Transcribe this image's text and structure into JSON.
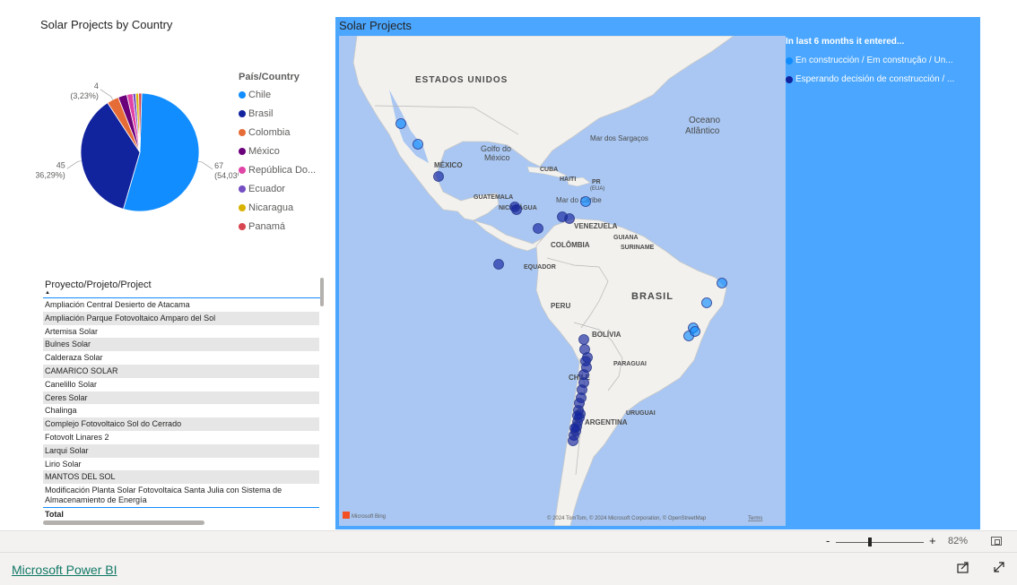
{
  "pie_visual": {
    "title": "Solar Projects by Country",
    "legend_title": "País/Country"
  },
  "chart_data": {
    "type": "pie",
    "title": "Solar Projects by Country",
    "legend_title": "País/Country",
    "legend_position": "right",
    "slices": [
      {
        "name": "Chile",
        "value": 67,
        "label": "67",
        "pct": "(54,03%)",
        "color": "#118dff"
      },
      {
        "name": "Brasil",
        "value": 45,
        "label": "45",
        "pct": "(36,29%)",
        "color": "#12239e"
      },
      {
        "name": "Colombia",
        "value": 4,
        "label": "4",
        "pct": "(3,23%)",
        "color": "#e66c37"
      },
      {
        "name": "México",
        "value": 3,
        "label": "",
        "pct": "",
        "color": "#6b007b"
      },
      {
        "name": "República Do...",
        "value": 2,
        "label": "",
        "pct": "",
        "color": "#e044a7"
      },
      {
        "name": "Ecuador",
        "value": 1,
        "label": "",
        "pct": "",
        "color": "#744ec2"
      },
      {
        "name": "Nicaragua",
        "value": 1,
        "label": "",
        "pct": "",
        "color": "#d9b300"
      },
      {
        "name": "Panamá",
        "value": 1,
        "label": "",
        "pct": "",
        "color": "#d64550"
      }
    ]
  },
  "table": {
    "header": "Proyecto/Projeto/Project",
    "rows": [
      "Ampliación Central Desierto de Atacama",
      "Ampliación Parque Fotovoltaico Amparo del Sol",
      "Artemisa Solar",
      "Bulnes Solar",
      "Calderaza Solar",
      "CAMARICO SOLAR",
      "Canelillo Solar",
      "Ceres Solar",
      "Chalinga",
      "Complejo Fotovoltaico Sol do Cerrado",
      "Fotovolt Linares 2",
      "Larqui Solar",
      "Lirio Solar",
      "MANTOS DEL SOL",
      "Modificación Planta Solar Fotovoltaica Santa Julia con Sistema de Almacenamiento de Energía"
    ],
    "total_label": "Total"
  },
  "map": {
    "title": "Solar Projects",
    "legend_title": "In last 6 months it entered...",
    "legend_items": [
      {
        "label": "En construcción / Em construção / Un...",
        "color": "#118dff"
      },
      {
        "label": "Esperando decisión de construcción / ...",
        "color": "#12239e"
      }
    ],
    "labels": {
      "usa": "ESTADOS UNIDOS",
      "ocean": "Oceano",
      "ocean2": "Atlântico",
      "sargasso": "Mar dos Sargaços",
      "gulf": "Golfo do",
      "gulf2": "México",
      "mexico": "MÉXICO",
      "cuba": "CUBA",
      "haiti": "HAITI",
      "pr": "PR",
      "eua": "(EUA)",
      "caribe": "Mar do Caribe",
      "guatemala": "GUATEMALA",
      "nicaragua": "NICARÁGUA",
      "venezuela": "VENEZUELA",
      "guiana": "GUIANA",
      "colombia": "COLÔMBIA",
      "suriname": "SURINAME",
      "equador": "EQUADOR",
      "brasil": "BRASIL",
      "peru": "PERU",
      "bolivia": "BOLÍVIA",
      "paraguai": "PARAGUAI",
      "chile": "CHILE",
      "uruguai": "URUGUAI",
      "argentina": "ARGENTINA"
    },
    "bing": "Microsoft Bing",
    "attribution": "© 2024 TomTom, © 2024 Microsoft Corporation, © OpenStreetMap",
    "terms": "Terms"
  },
  "zoom": {
    "minus": "-",
    "plus": "+",
    "level": "82%"
  },
  "footer": {
    "link": "Microsoft Power BI"
  }
}
